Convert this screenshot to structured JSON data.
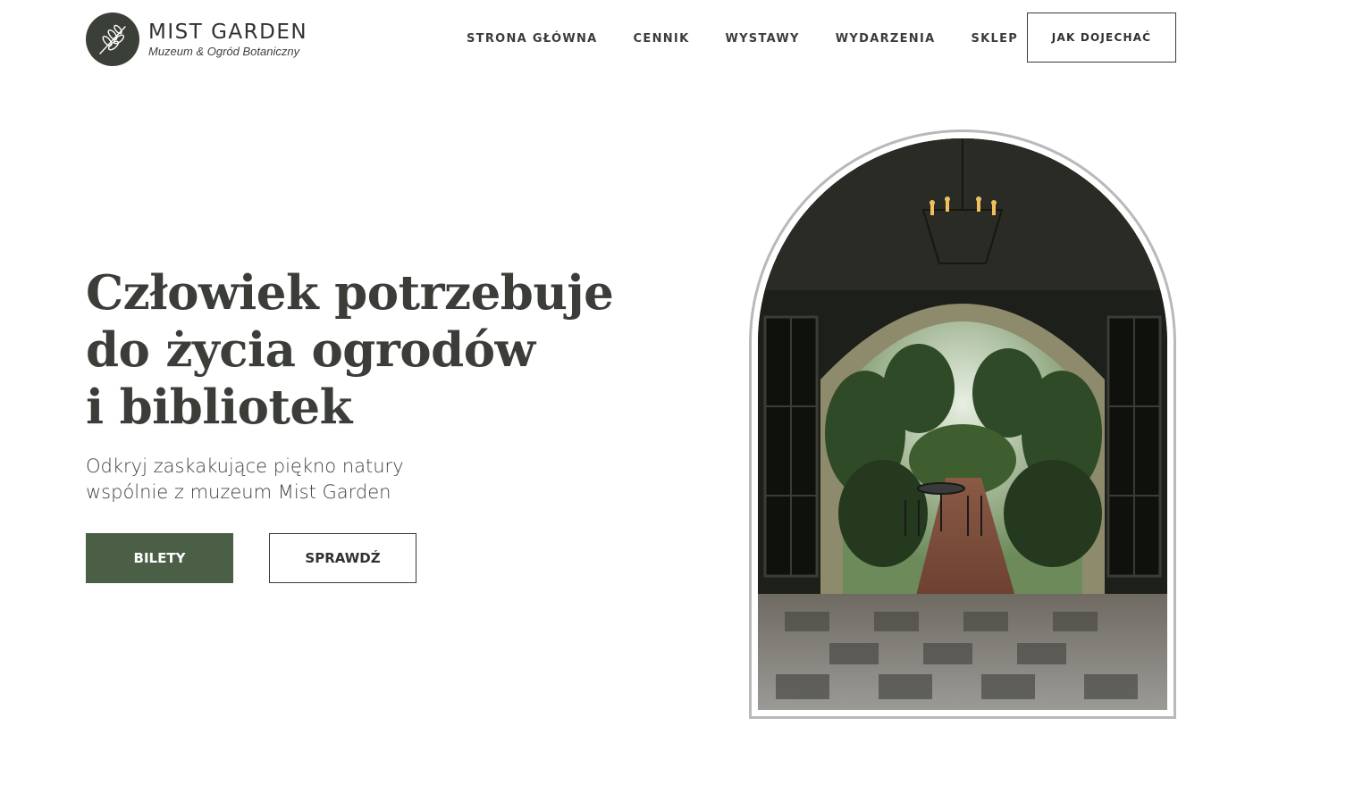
{
  "brand": {
    "name": "MIST GARDEN",
    "tagline": "Muzeum & Ogród Botaniczny",
    "logo_icon": "leaf-branch-icon"
  },
  "nav": {
    "items": [
      {
        "label": "STRONA GŁÓWNA"
      },
      {
        "label": "CENNIK"
      },
      {
        "label": "WYSTAWY"
      },
      {
        "label": "WYDARZENIA"
      },
      {
        "label": "SKLEP"
      }
    ],
    "cta_label": "JAK DOJECHAĆ"
  },
  "hero": {
    "heading_lines": [
      "Człowiek potrzebuje",
      "do życia ogrodów",
      "i bibliotek"
    ],
    "sub_lines": [
      "Odkryj zaskakujące piękno natury",
      "wspólnie z muzeum Mist Garden"
    ],
    "primary_button": "BILETY",
    "secondary_button": "SPRAWDŹ"
  },
  "colors": {
    "accent_green": "#4a5f46",
    "logo_dark": "#3a3f37",
    "text_dark": "#2f332d"
  }
}
